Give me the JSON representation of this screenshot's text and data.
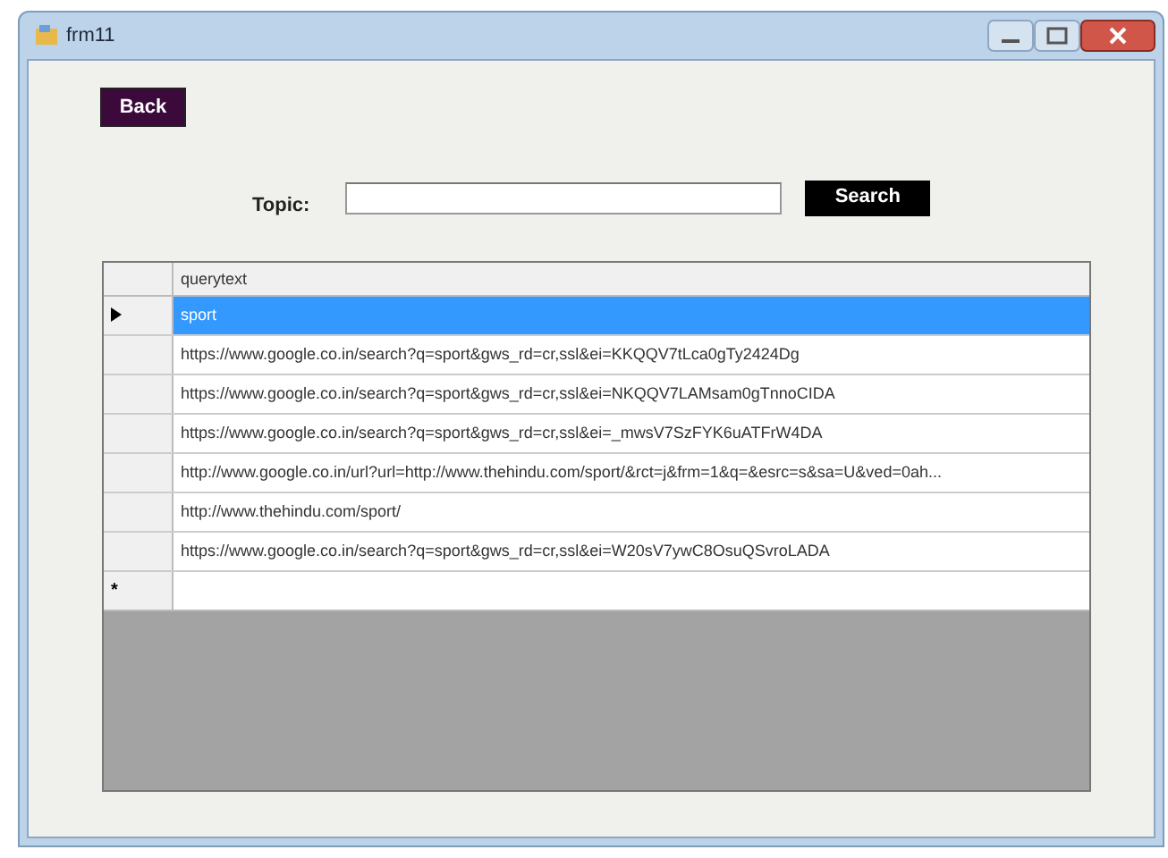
{
  "window": {
    "title": "frm11"
  },
  "back_button": {
    "label": "Back"
  },
  "topic": {
    "label": "Topic:"
  },
  "search_button": {
    "label": "Search"
  },
  "grid": {
    "columns": [
      "querytext"
    ],
    "rows": [
      {
        "text": "sport",
        "selected": true
      },
      {
        "text": "https://www.google.co.in/search?q=sport&gws_rd=cr,ssl&ei=KKQQV7tLca0gTy2424Dg",
        "selected": false
      },
      {
        "text": "https://www.google.co.in/search?q=sport&gws_rd=cr,ssl&ei=NKQQV7LAMsam0gTnnoCIDA",
        "selected": false
      },
      {
        "text": "https://www.google.co.in/search?q=sport&gws_rd=cr,ssl&ei=_mwsV7SzFYK6uATFrW4DA",
        "selected": false
      },
      {
        "text": "http://www.google.co.in/url?url=http://www.thehindu.com/sport/&rct=j&frm=1&q=&esrc=s&sa=U&ved=0ah...",
        "selected": false
      },
      {
        "text": "http://www.thehindu.com/sport/",
        "selected": false
      },
      {
        "text": "https://www.google.co.in/search?q=sport&gws_rd=cr,ssl&ei=W20sV7ywC8OsuQSvroLADA",
        "selected": false
      }
    ],
    "new_row_marker": "*"
  }
}
